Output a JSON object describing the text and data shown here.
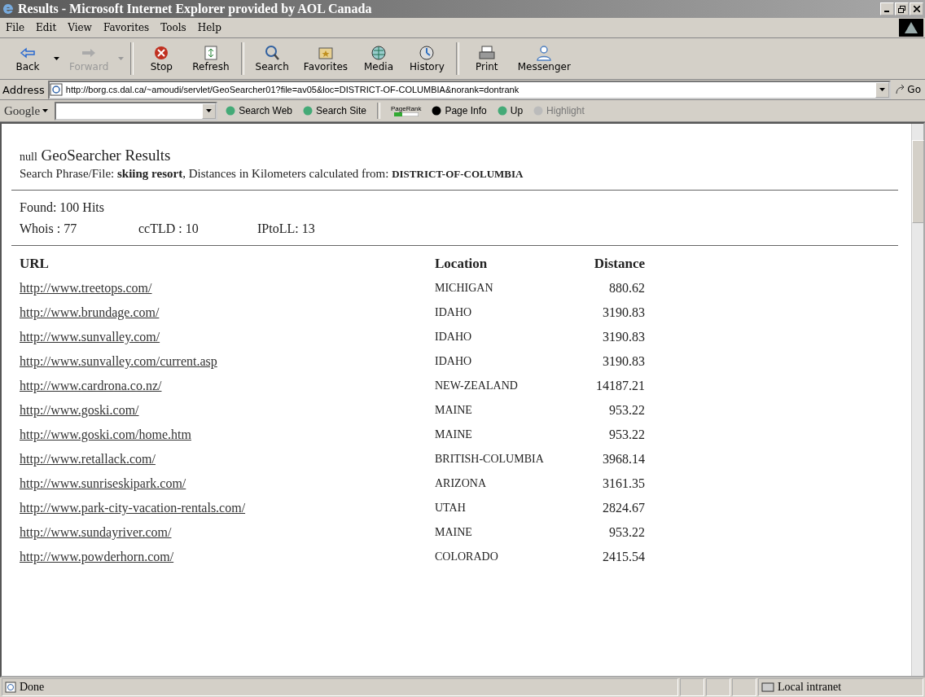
{
  "window": {
    "title": "Results - Microsoft Internet Explorer provided by AOL Canada"
  },
  "menu": [
    "File",
    "Edit",
    "View",
    "Favorites",
    "Tools",
    "Help"
  ],
  "toolbar": [
    {
      "label": "Back",
      "kind": "back",
      "disabled": false,
      "dropdown": true
    },
    {
      "label": "Forward",
      "kind": "forward",
      "disabled": true,
      "dropdown": true
    },
    {
      "label": "Stop",
      "kind": "stop",
      "disabled": false,
      "dropdown": false
    },
    {
      "label": "Refresh",
      "kind": "refresh",
      "disabled": false,
      "dropdown": false
    },
    {
      "label": "Search",
      "kind": "search",
      "disabled": false,
      "dropdown": false
    },
    {
      "label": "Favorites",
      "kind": "favorites",
      "disabled": false,
      "dropdown": false
    },
    {
      "label": "Media",
      "kind": "media",
      "disabled": false,
      "dropdown": false
    },
    {
      "label": "History",
      "kind": "history",
      "disabled": false,
      "dropdown": false
    },
    {
      "label": "Print",
      "kind": "print",
      "disabled": false,
      "dropdown": false
    },
    {
      "label": "Messenger",
      "kind": "messenger",
      "disabled": false,
      "dropdown": false
    }
  ],
  "address": {
    "label": "Address",
    "value": "http://borg.cs.dal.ca/~amoudi/servlet/GeoSearcher01?file=av05&loc=DISTRICT-OF-COLUMBIA&norank=dontrank",
    "go": "Go"
  },
  "google_bar": {
    "label": "Google",
    "items": [
      {
        "label": "Search Web",
        "disabled": false
      },
      {
        "label": "Search Site",
        "disabled": false
      },
      {
        "label": "PageRank",
        "disabled": false
      },
      {
        "label": "Page Info",
        "disabled": false
      },
      {
        "label": "Up",
        "disabled": false
      },
      {
        "label": "Highlight",
        "disabled": true
      }
    ]
  },
  "page": {
    "title_prefix": "null",
    "title": "GeoSearcher Results",
    "subtitle": "Search Phrase/File: **skiing resort**, Distances in Kilometers calculated from: ",
    "location": "DISTRICT-OF-COLUMBIA",
    "found": "Found: 100 Hits",
    "stats": [
      "Whois : 77",
      "ccTLD : 10",
      "IPtoLL: 13"
    ],
    "columns": [
      "URL",
      "Location",
      "Distance"
    ],
    "rows": [
      {
        "url": "http://www.treetops.com/",
        "location": "MICHIGAN",
        "distance": "880.62"
      },
      {
        "url": "http://www.brundage.com/",
        "location": "IDAHO",
        "distance": "3190.83"
      },
      {
        "url": "http://www.sunvalley.com/",
        "location": "IDAHO",
        "distance": "3190.83"
      },
      {
        "url": "http://www.sunvalley.com/current.asp",
        "location": "IDAHO",
        "distance": "3190.83"
      },
      {
        "url": "http://www.cardrona.co.nz/",
        "location": "NEW-ZEALAND",
        "distance": "14187.21"
      },
      {
        "url": "http://www.goski.com/",
        "location": "MAINE",
        "distance": "953.22"
      },
      {
        "url": "http://www.goski.com/home.htm",
        "location": "MAINE",
        "distance": "953.22"
      },
      {
        "url": "http://www.retallack.com/",
        "location": "BRITISH-COLUMBIA",
        "distance": "3968.14"
      },
      {
        "url": "http://www.sunriseskipark.com/",
        "location": "ARIZONA",
        "distance": "3161.35"
      },
      {
        "url": "http://www.park-city-vacation-rentals.com/",
        "location": "UTAH",
        "distance": "2824.67"
      },
      {
        "url": "http://www.sundayriver.com/",
        "location": "MAINE",
        "distance": "953.22"
      },
      {
        "url": "http://www.powderhorn.com/",
        "location": "COLORADO",
        "distance": "2415.54"
      }
    ]
  },
  "status_bar": {
    "text": "Done",
    "zone": "Local intranet"
  }
}
